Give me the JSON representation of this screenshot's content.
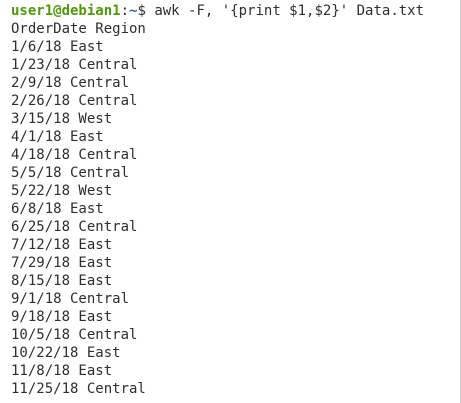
{
  "prompt": {
    "user_host": "user1@debian1",
    "separator": ":",
    "path": "~",
    "symbol": "$ ",
    "command": "awk -F, '{print $1,$2}' Data.txt"
  },
  "output": [
    "OrderDate Region",
    "1/6/18 East",
    "1/23/18 Central",
    "2/9/18 Central",
    "2/26/18 Central",
    "3/15/18 West",
    "4/1/18 East",
    "4/18/18 Central",
    "5/5/18 Central",
    "5/22/18 West",
    "6/8/18 East",
    "6/25/18 Central",
    "7/12/18 East",
    "7/29/18 East",
    "8/15/18 East",
    "9/1/18 Central",
    "9/18/18 East",
    "10/5/18 Central",
    "10/22/18 East",
    "11/8/18 East",
    "11/25/18 Central"
  ],
  "colors": {
    "prompt_user": "#4e9a06",
    "prompt_path": "#3465a4",
    "text": "#2e2e2e",
    "background": "#ffffff"
  }
}
